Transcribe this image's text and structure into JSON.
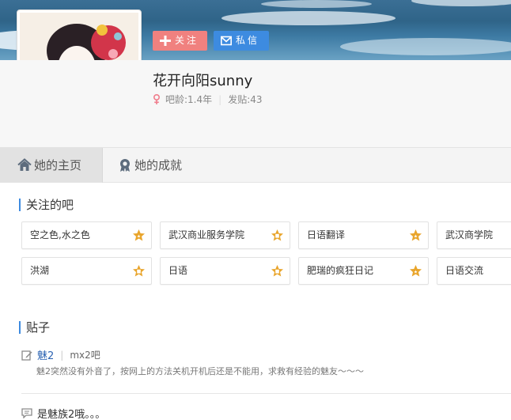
{
  "profile": {
    "username": "花开向阳sunny",
    "age_label": "吧龄:1.4年",
    "posts_label": "发贴:43"
  },
  "actions": {
    "follow_label": "关注",
    "message_label": "私信"
  },
  "tabs": [
    {
      "label": "她的主页",
      "icon": "home-icon",
      "active": true
    },
    {
      "label": "她的成就",
      "icon": "medal-icon",
      "active": false
    }
  ],
  "followed_bars": {
    "title": "关注的吧",
    "items": [
      {
        "name": "空之色,水之色",
        "level": "star-badge"
      },
      {
        "name": "武汉商业服务学院",
        "level": "level-badge"
      },
      {
        "name": "日语翻译",
        "level": "star-badge"
      },
      {
        "name": "武汉商学院",
        "level": ""
      },
      {
        "name": "洪湖",
        "level": "level-badge"
      },
      {
        "name": "日语",
        "level": "level-badge"
      },
      {
        "name": "肥瑞的疯狂日记",
        "level": "star-badge"
      },
      {
        "name": "日语交流",
        "level": ""
      }
    ]
  },
  "posts": {
    "title": "贴子",
    "items": [
      {
        "title": "魅2",
        "bar": "mx2吧",
        "excerpt": "魅2突然没有外音了，按网上的方法关机开机后还是不能用，求救有经验的魅友～～～"
      },
      {
        "title": "是魅族2哦。。。"
      }
    ]
  },
  "colors": {
    "accent": "#3d8be0",
    "follow": "#f0817f",
    "badge": "#e9a52c"
  }
}
